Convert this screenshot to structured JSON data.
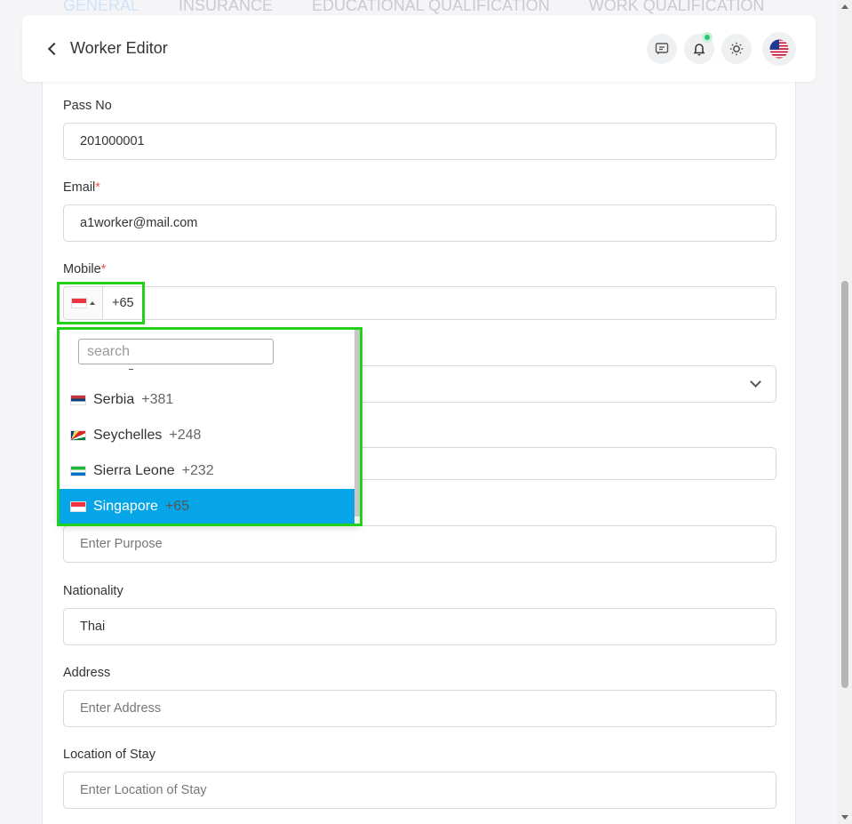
{
  "tabs": [
    "GENERAL",
    "INSURANCE",
    "EDUCATIONAL QUALIFICATION",
    "WORK QUALIFICATION"
  ],
  "header": {
    "title": "Worker Editor"
  },
  "fields": {
    "pass_no": {
      "label": "Pass No",
      "value": "201000001"
    },
    "email": {
      "label": "Email",
      "required_mark": "*",
      "value": "a1worker@mail.com"
    },
    "mobile": {
      "label": "Mobile",
      "required_mark": "*",
      "dial_code": "+65"
    },
    "purpose": {
      "placeholder": "Enter Purpose"
    },
    "nationality": {
      "label": "Nationality",
      "value": "Thai"
    },
    "address": {
      "label": "Address",
      "placeholder": "Enter Address"
    },
    "location_of_stay": {
      "label": "Location of Stay",
      "placeholder": "Enter Location of Stay"
    }
  },
  "country_dropdown": {
    "search_placeholder": "search",
    "items": [
      {
        "name": "Serbia",
        "code": "+381",
        "flag": "rs"
      },
      {
        "name": "Seychelles",
        "code": "+248",
        "flag": "sc"
      },
      {
        "name": "Sierra Leone",
        "code": "+232",
        "flag": "sl"
      },
      {
        "name": "Singapore",
        "code": "+65",
        "flag": "sg",
        "selected": true
      }
    ]
  },
  "colors": {
    "highlight": "#23d11a",
    "selected_bg": "#06a5e8",
    "required": "#ea5455",
    "notify_dot": "#28c76f"
  }
}
